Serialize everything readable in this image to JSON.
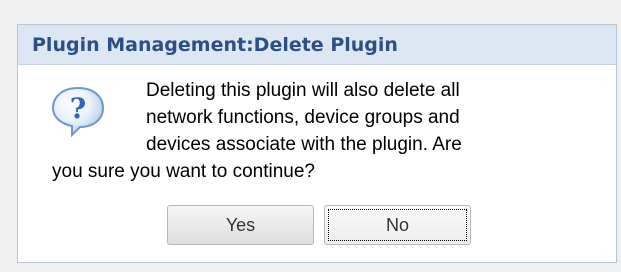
{
  "dialog": {
    "title": "Plugin Management:Delete Plugin",
    "icon": "question-icon",
    "message_lines": [
      "Deleting this plugin will also delete all",
      "network functions, device groups and",
      "devices associate with the plugin. Are",
      "you sure you want to continue?"
    ],
    "buttons": {
      "yes_label": "Yes",
      "no_label": "No"
    },
    "colors": {
      "title_text": "#2d4f86",
      "title_bar": "#dde7f3",
      "icon_blue": "#3b75c8"
    }
  }
}
